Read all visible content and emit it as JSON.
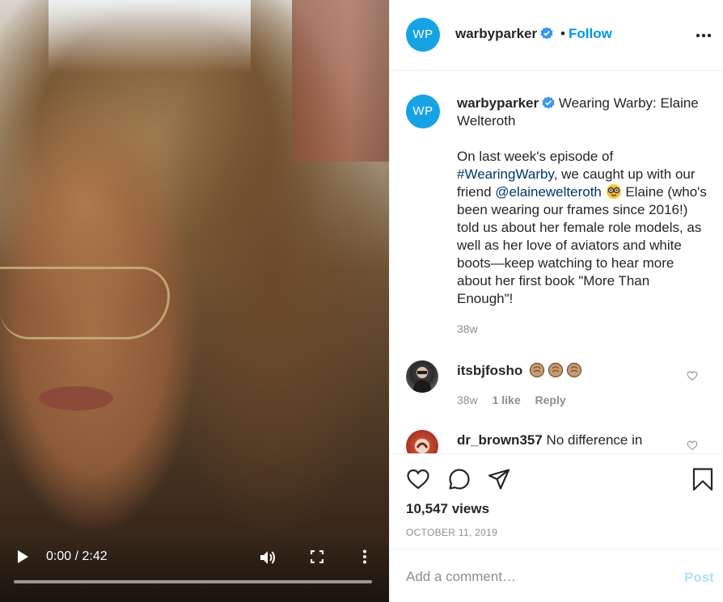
{
  "post": {
    "avatar_initials": "WP",
    "username": "warbyparker",
    "follow_label": "Follow",
    "dot": "•"
  },
  "video": {
    "time": "0:00 / 2:42"
  },
  "caption": {
    "username": "warbyparker",
    "title": "Wearing Warby: Elaine Welteroth",
    "text_1": "On last week's episode of",
    "hashtag": "#WearingWarby",
    "text_2": ", we caught up with our friend",
    "mention": "@elainewelteroth",
    "text_3": "Elaine (who's been wearing our frames since 2016!) told us about her female role models, as well as her love of aviators and white boots—keep watching to hear more about her first book \"More Than Enough\"!",
    "time": "38w"
  },
  "comments": [
    {
      "username": "itsbjfosho",
      "time": "38w",
      "likes": "1 like",
      "reply": "Reply"
    },
    {
      "username": "dr_brown357",
      "text": "No difference in"
    }
  ],
  "actions": {
    "views": "10,547 views",
    "date": "OCTOBER 11, 2019"
  },
  "composer": {
    "placeholder": "Add a comment…",
    "post_label": "Post"
  },
  "colors": {
    "accent": "#0095f6",
    "brand_avatar": "#16a3e3",
    "link": "#00376b",
    "muted": "#8e8e8e"
  },
  "icons": [
    "play-icon",
    "volume-icon",
    "fullscreen-icon",
    "more-vert-icon",
    "verified-icon",
    "more-icon",
    "heart-icon",
    "comment-icon",
    "share-icon",
    "save-icon",
    "nerd-face-icon",
    "clap-icon"
  ]
}
